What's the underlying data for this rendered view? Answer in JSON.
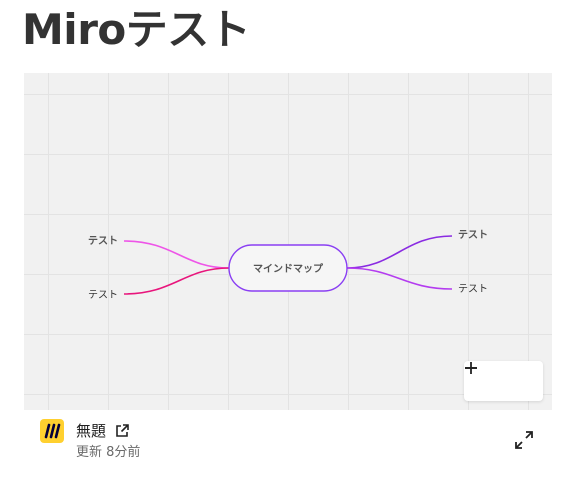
{
  "page": {
    "title": "Miroテスト"
  },
  "board": {
    "center_node": "マインドマップ",
    "left_nodes": [
      "テスト",
      "テスト"
    ],
    "right_nodes": [
      "テスト",
      "テスト"
    ],
    "colors": {
      "center_border": "#8a3ff3",
      "left_top": "#ee55e8",
      "left_bottom": "#e8157c",
      "right_top": "#8a2be2",
      "right_bottom": "#b43cf0"
    }
  },
  "zoom": {
    "out_icon": "minus-icon",
    "in_icon": "plus-icon"
  },
  "footer": {
    "logo_icon": "miro-logo-icon",
    "file_title": "無題",
    "link_icon": "external-link-icon",
    "updated": "更新 8分前",
    "fullscreen_icon": "expand-icon"
  }
}
